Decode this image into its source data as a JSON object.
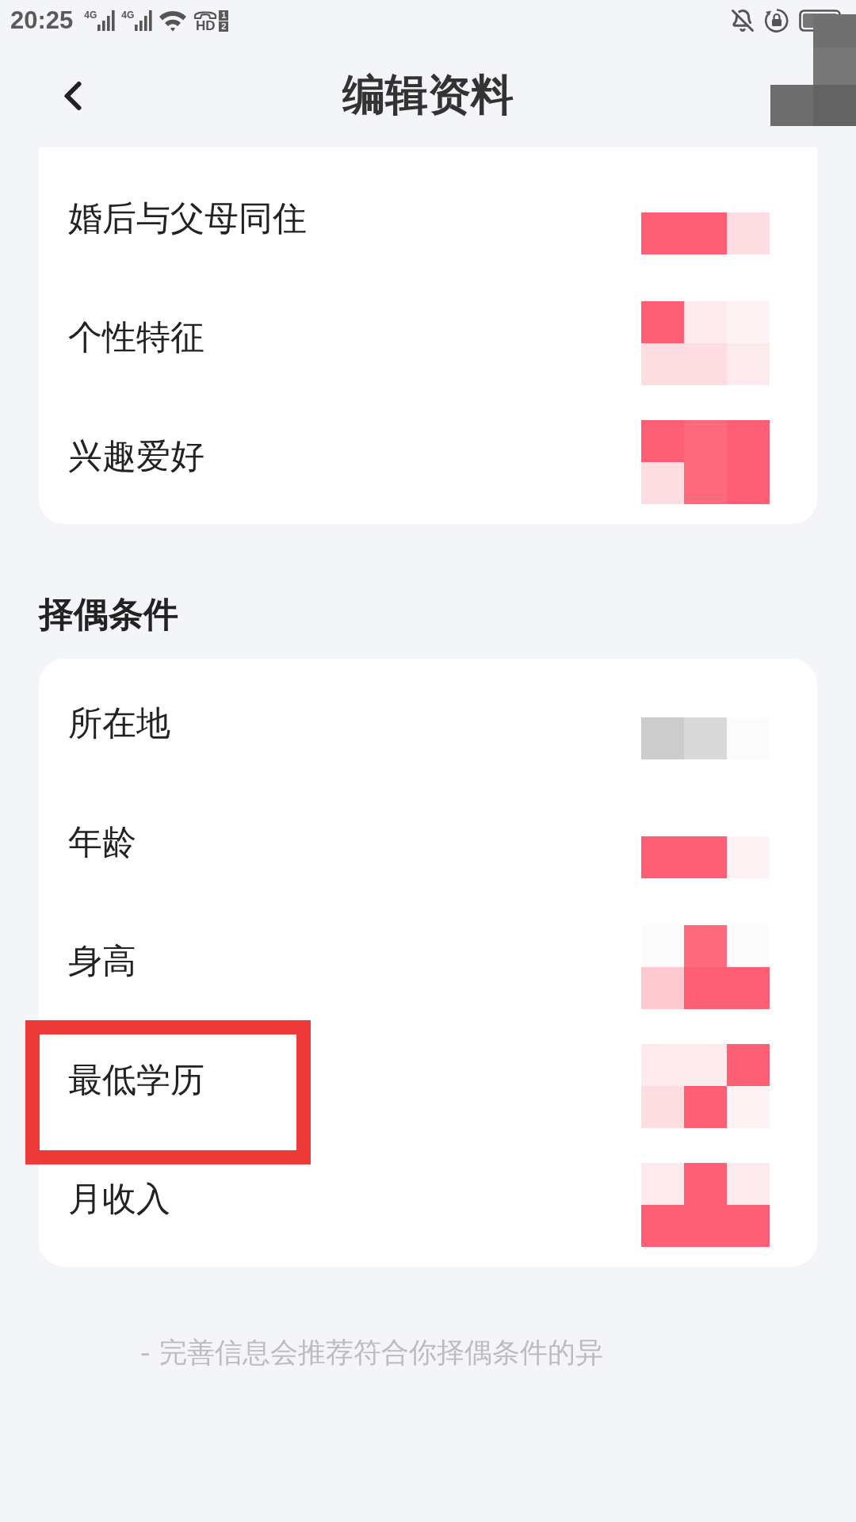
{
  "status_bar": {
    "time": "20:25",
    "signals": [
      {
        "network": "4G"
      },
      {
        "network": "4G"
      }
    ],
    "call_label": "HD",
    "sim_slots": [
      "1",
      "2"
    ]
  },
  "header": {
    "title": "编辑资料"
  },
  "sections": [
    {
      "rows": [
        {
          "label": "婚后与父母同住",
          "masked": true,
          "highlighted": false
        },
        {
          "label": "个性特征",
          "masked": true,
          "highlighted": false
        },
        {
          "label": "兴趣爱好",
          "masked": true,
          "highlighted": false
        }
      ]
    },
    {
      "title": "择偶条件",
      "rows": [
        {
          "label": "所在地",
          "masked": true,
          "highlighted": false
        },
        {
          "label": "年龄",
          "masked": true,
          "highlighted": false
        },
        {
          "label": "身高",
          "masked": true,
          "highlighted": false
        },
        {
          "label": "最低学历",
          "masked": true,
          "highlighted": true
        },
        {
          "label": "月收入",
          "masked": true,
          "highlighted": false
        }
      ]
    }
  ],
  "footer_note": "- 完善信息会推荐符合你择偶条件的异"
}
